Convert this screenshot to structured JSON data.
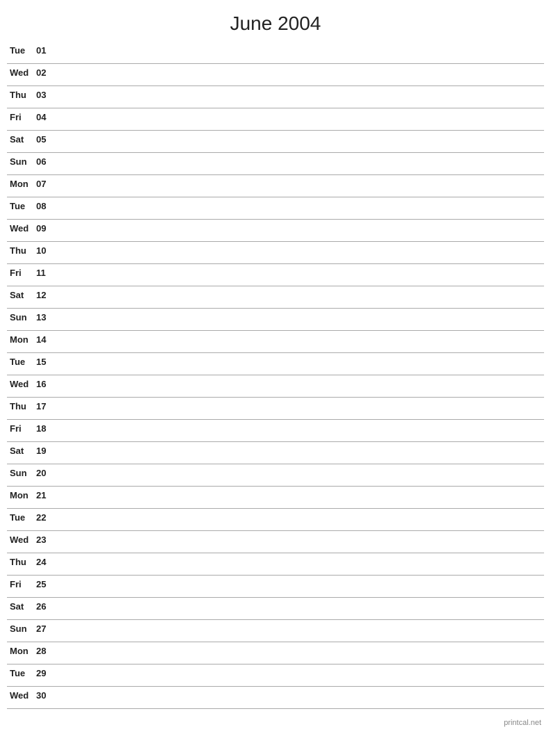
{
  "title": "June 2004",
  "days": [
    {
      "name": "Tue",
      "num": "01"
    },
    {
      "name": "Wed",
      "num": "02"
    },
    {
      "name": "Thu",
      "num": "03"
    },
    {
      "name": "Fri",
      "num": "04"
    },
    {
      "name": "Sat",
      "num": "05"
    },
    {
      "name": "Sun",
      "num": "06"
    },
    {
      "name": "Mon",
      "num": "07"
    },
    {
      "name": "Tue",
      "num": "08"
    },
    {
      "name": "Wed",
      "num": "09"
    },
    {
      "name": "Thu",
      "num": "10"
    },
    {
      "name": "Fri",
      "num": "11"
    },
    {
      "name": "Sat",
      "num": "12"
    },
    {
      "name": "Sun",
      "num": "13"
    },
    {
      "name": "Mon",
      "num": "14"
    },
    {
      "name": "Tue",
      "num": "15"
    },
    {
      "name": "Wed",
      "num": "16"
    },
    {
      "name": "Thu",
      "num": "17"
    },
    {
      "name": "Fri",
      "num": "18"
    },
    {
      "name": "Sat",
      "num": "19"
    },
    {
      "name": "Sun",
      "num": "20"
    },
    {
      "name": "Mon",
      "num": "21"
    },
    {
      "name": "Tue",
      "num": "22"
    },
    {
      "name": "Wed",
      "num": "23"
    },
    {
      "name": "Thu",
      "num": "24"
    },
    {
      "name": "Fri",
      "num": "25"
    },
    {
      "name": "Sat",
      "num": "26"
    },
    {
      "name": "Sun",
      "num": "27"
    },
    {
      "name": "Mon",
      "num": "28"
    },
    {
      "name": "Tue",
      "num": "29"
    },
    {
      "name": "Wed",
      "num": "30"
    }
  ],
  "footer": "printcal.net"
}
